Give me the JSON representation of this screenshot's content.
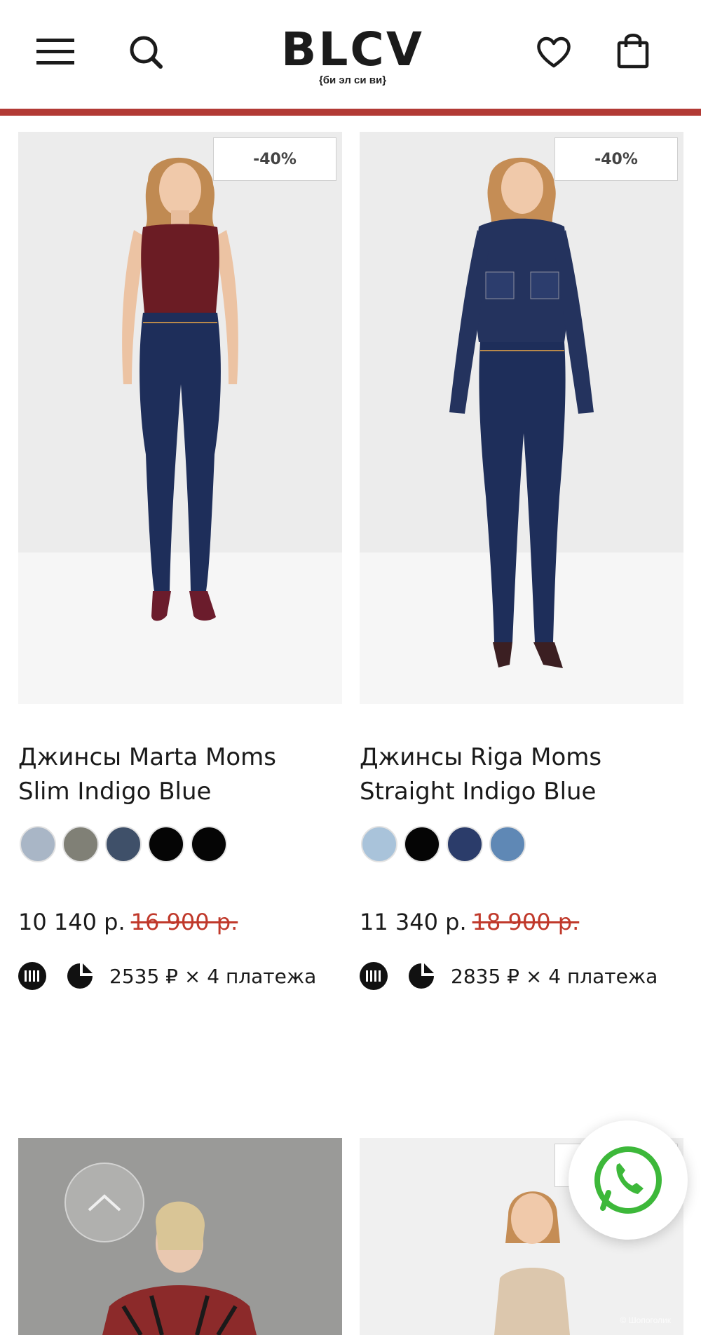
{
  "header": {
    "logo": "BLCV",
    "logo_sub": "{би эл си ви}",
    "icons": [
      "menu-icon",
      "search-icon",
      "heart-icon",
      "bag-icon"
    ],
    "accent_color": "#b23a35"
  },
  "products": [
    {
      "badge": "-40%",
      "title_line1": "Джинсы Marta Moms",
      "title_line2": "Slim Indigo Blue",
      "swatches": [
        "#a9b6c6",
        "#808076",
        "#3f5069",
        "#050505",
        "#050505"
      ],
      "price": "10 140 р.",
      "old_price": "16 900 р.",
      "installment": "2535 ₽ × 4 платежа"
    },
    {
      "badge": "-40%",
      "title_line1": "Джинсы Riga Moms",
      "title_line2": "Straight Indigo Blue",
      "swatches": [
        "#a9c3da",
        "#050505",
        "#2b3c6a",
        "#5f88b5"
      ],
      "price": "11 340 р.",
      "old_price": "18 900 р.",
      "installment": "2835 ₽ × 4 платежа"
    }
  ],
  "watermark": "© Шопоголик"
}
